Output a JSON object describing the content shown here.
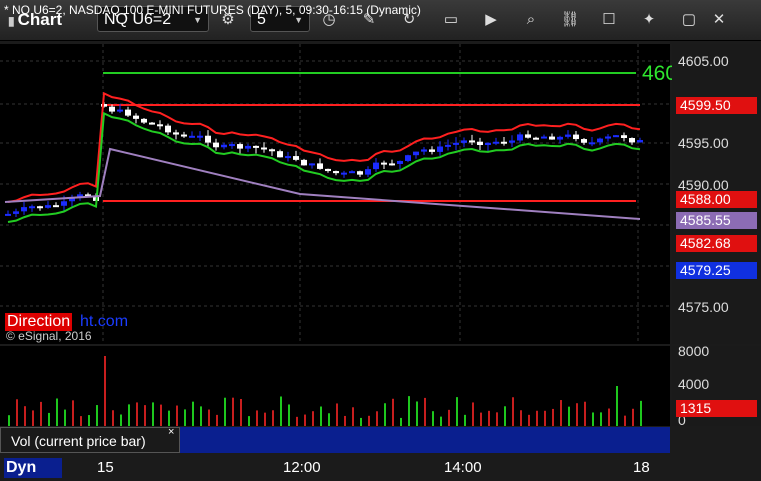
{
  "toolbar": {
    "title": "Chart",
    "symbol": "NQ U6=2",
    "interval": "5"
  },
  "chart": {
    "header": "* NQ U6=2, NASDAQ 100 E-MINI FUTURES (DAY), 5, 09:30-16:15 (Dynamic)",
    "line_label": "460",
    "watermark_red": "Direction",
    "watermark_blue": "ht.com",
    "copyright": "© eSignal, 2016",
    "colors": {
      "up": "#1b2cff",
      "down": "#ffffff",
      "red_line": "#ff2020",
      "green_line": "#22cc22",
      "purple_line": "#a080c0",
      "vol_up": "#1ec81e",
      "vol_down": "#c81e1e"
    }
  },
  "price_axis": {
    "labels": [
      "4605.00",
      "4595.00",
      "4590.00",
      "4575.00"
    ],
    "tags": [
      {
        "text": "4599.50",
        "color": "#e01010"
      },
      {
        "text": "4588.00",
        "color": "#e01010"
      },
      {
        "text": "4585.55",
        "color": "#8c6cb4"
      },
      {
        "text": "4582.68",
        "color": "#e01010"
      },
      {
        "text": "4579.25",
        "color": "#1030e0"
      }
    ]
  },
  "volume_axis": {
    "labels": [
      "8000",
      "4000",
      "0"
    ],
    "tag": "1315"
  },
  "volume_panel": {
    "label": "Vol (current price bar)",
    "close": "×"
  },
  "x_axis": {
    "labels": [
      "15",
      "12:00",
      "14:00",
      "18"
    ],
    "dyn": "Dyn"
  }
}
